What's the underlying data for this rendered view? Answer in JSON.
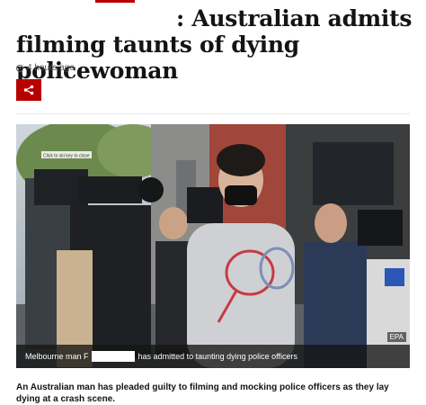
{
  "headline": ": Australian admits filming taunts of dying policewoman",
  "timestamp": "4 hours ago",
  "share": {
    "icon": "share-icon",
    "color": "#b80000"
  },
  "image": {
    "credit": "EPA",
    "caption_start": "Melbourne man F",
    "caption_end": "has admitted to taunting dying police officers",
    "tooltip": "Click to ski key to close"
  },
  "intro": "An Australian man has pleaded guilty to filming and mocking police officers as they lay dying at a crash scene."
}
